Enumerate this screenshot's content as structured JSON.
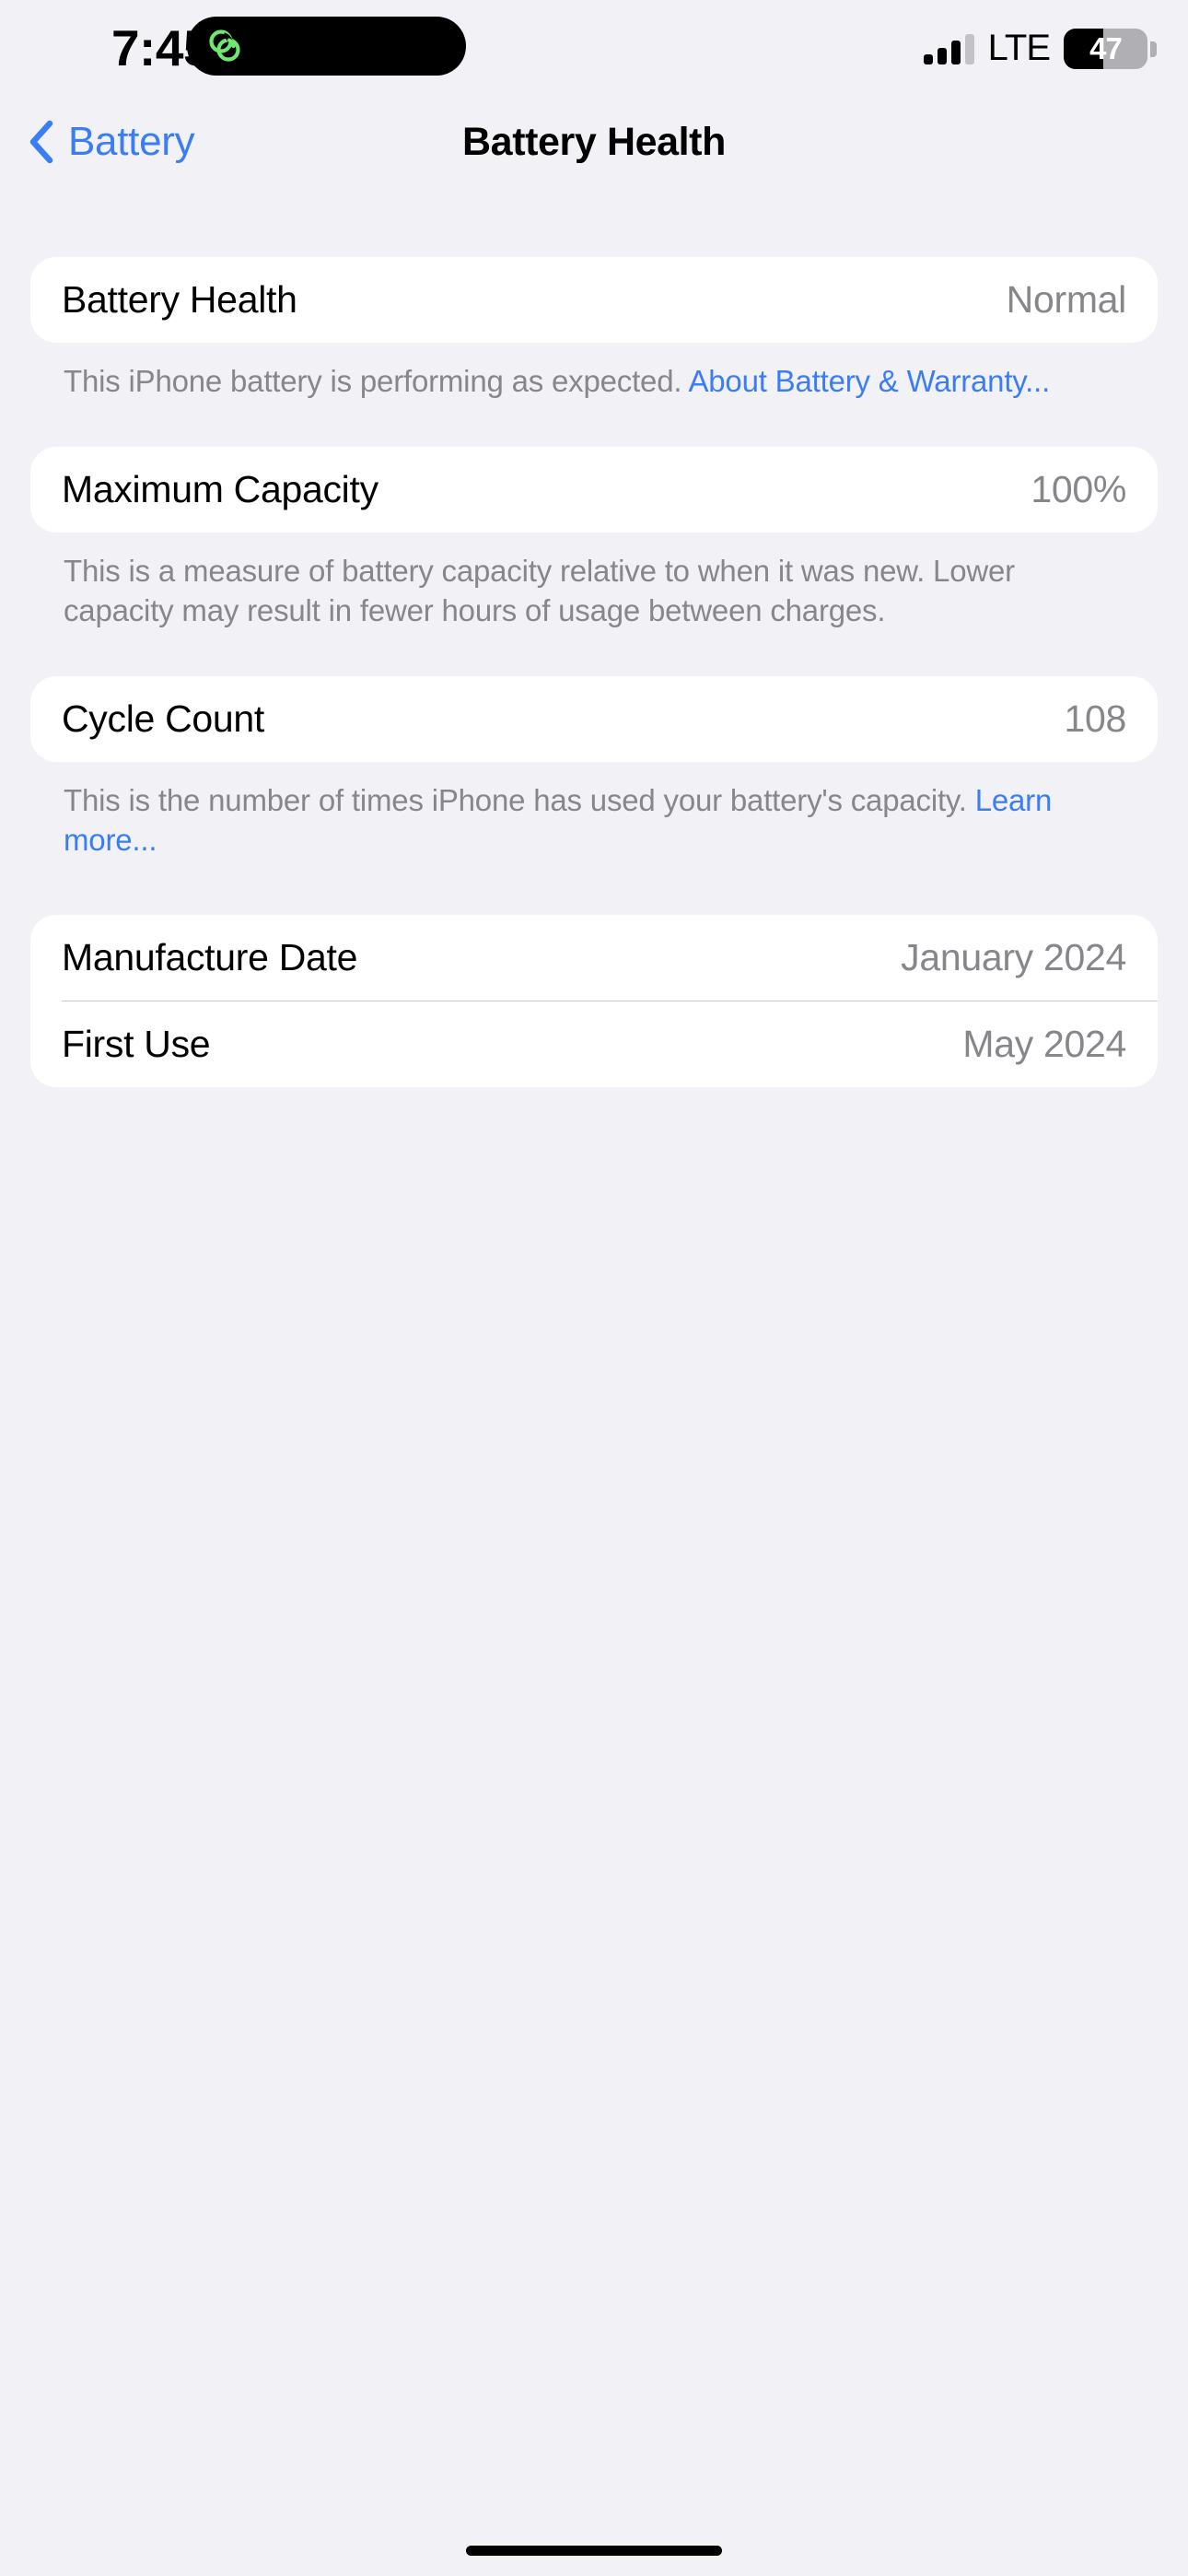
{
  "status_bar": {
    "time": "7:45",
    "dynamic_island_icon": "green-loop-icon",
    "signal_icon": "cellular-signal-icon",
    "signal_bars_filled": 3,
    "signal_bars_total": 4,
    "network": "LTE",
    "battery_percent": "47",
    "battery_level": 47,
    "battery_icon": "battery-icon"
  },
  "nav": {
    "back_icon": "chevron-left-icon",
    "back_label": "Battery",
    "title": "Battery Health"
  },
  "sections": {
    "battery_health": {
      "label": "Battery Health",
      "value": "Normal",
      "footer_text": "This iPhone battery is performing as expected. ",
      "footer_link": "About Battery & Warranty..."
    },
    "maximum_capacity": {
      "label": "Maximum Capacity",
      "value": "100%",
      "footer_text": "This is a measure of battery capacity relative to when it was new. Lower capacity may result in fewer hours of usage between charges."
    },
    "cycle_count": {
      "label": "Cycle Count",
      "value": "108",
      "footer_text": "This is the number of times iPhone has used your battery's capacity. ",
      "footer_link": "Learn more..."
    },
    "dates": {
      "manufacture_label": "Manufacture Date",
      "manufacture_value": "January 2024",
      "first_use_label": "First Use",
      "first_use_value": "May 2024"
    }
  },
  "colors": {
    "background": "#F1F1F6",
    "card": "#FFFFFF",
    "label": "#000000",
    "value_gray": "#86868B",
    "link_blue": "#3B7DF5",
    "island_icon_green": "#6EE870"
  }
}
